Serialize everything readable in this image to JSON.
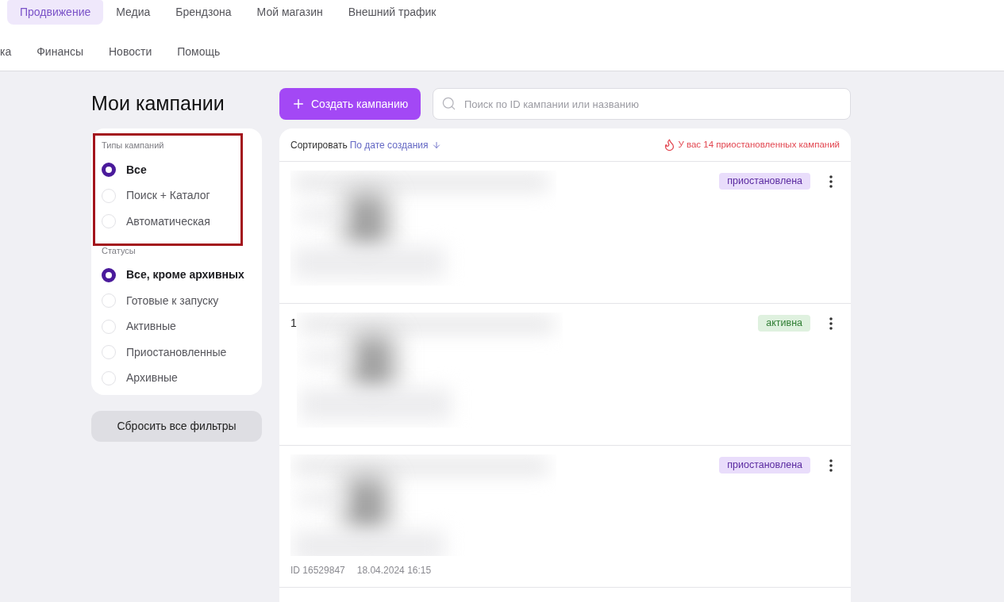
{
  "nav": {
    "primary": [
      {
        "label": "Продвижение",
        "selected": true
      },
      {
        "label": "Медиа",
        "selected": false
      },
      {
        "label": "Брендзона",
        "selected": false
      },
      {
        "label": "Мой магазин",
        "selected": false
      },
      {
        "label": "Внешний трафик",
        "selected": false
      }
    ],
    "secondary": [
      {
        "label": "ка"
      },
      {
        "label": "Финансы"
      },
      {
        "label": "Новости"
      },
      {
        "label": "Помощь"
      }
    ]
  },
  "page": {
    "title": "Мои кампании"
  },
  "filters": {
    "groups": [
      {
        "title": "Типы кампаний",
        "highlighted": true,
        "options": [
          {
            "label": "Все",
            "selected": true
          },
          {
            "label": "Поиск + Каталог",
            "selected": false
          },
          {
            "label": "Автоматическая",
            "selected": false
          }
        ]
      },
      {
        "title": "Статусы",
        "highlighted": false,
        "options": [
          {
            "label": "Все, кроме архивных",
            "selected": true
          },
          {
            "label": "Готовые к запуску",
            "selected": false
          },
          {
            "label": "Активные",
            "selected": false
          },
          {
            "label": "Приостановленные",
            "selected": false
          },
          {
            "label": "Архивные",
            "selected": false
          }
        ]
      }
    ],
    "reset_button": "Сбросить все фильтры"
  },
  "toolbar": {
    "create_button": "Создать кампанию",
    "search": {
      "placeholder": "Поиск по ID кампании или названию"
    }
  },
  "list": {
    "sort": {
      "label": "Сортировать",
      "value": "По дате создания"
    },
    "alert": "У вас 14 приостановленных кампаний",
    "campaigns": [
      {
        "kind": "paused",
        "badge": "приостановлена"
      },
      {
        "kind": "active",
        "badge": "активна",
        "title": "1"
      },
      {
        "kind": "paused",
        "badge": "приостановлена",
        "id": "ID 16529847",
        "date": "18.04.2024 16:15"
      }
    ]
  }
}
